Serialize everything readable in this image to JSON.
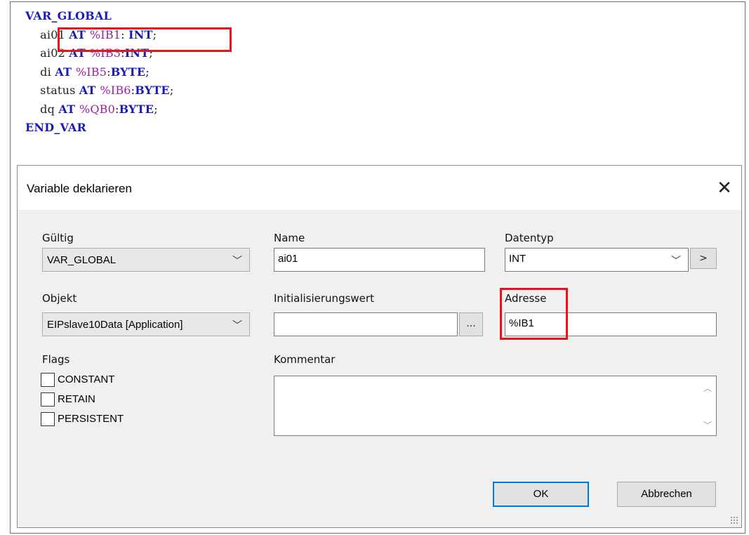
{
  "code": {
    "lines": [
      {
        "indent": "",
        "parts": [
          {
            "t": "VAR_GLOBAL",
            "c": "kw"
          }
        ]
      },
      {
        "indent": "    ",
        "parts": [
          {
            "t": "ai01 ",
            "c": "ident"
          },
          {
            "t": "AT ",
            "c": "kw"
          },
          {
            "t": "%IB1",
            "c": "addr"
          },
          {
            "t": ": ",
            "c": "ident"
          },
          {
            "t": "INT",
            "c": "kw"
          },
          {
            "t": ";",
            "c": "ident"
          }
        ]
      },
      {
        "indent": "    ",
        "parts": [
          {
            "t": "ai02 ",
            "c": "ident"
          },
          {
            "t": "AT ",
            "c": "kw"
          },
          {
            "t": "%IB3",
            "c": "addr"
          },
          {
            "t": ":",
            "c": "ident"
          },
          {
            "t": "INT",
            "c": "kw"
          },
          {
            "t": ";",
            "c": "ident"
          }
        ]
      },
      {
        "indent": "    ",
        "parts": [
          {
            "t": "di ",
            "c": "ident"
          },
          {
            "t": "AT ",
            "c": "kw"
          },
          {
            "t": "%IB5",
            "c": "addr"
          },
          {
            "t": ":",
            "c": "ident"
          },
          {
            "t": "BYTE",
            "c": "kw"
          },
          {
            "t": ";",
            "c": "ident"
          }
        ]
      },
      {
        "indent": "    ",
        "parts": [
          {
            "t": "status ",
            "c": "ident"
          },
          {
            "t": "AT ",
            "c": "kw"
          },
          {
            "t": "%IB6",
            "c": "addr"
          },
          {
            "t": ":",
            "c": "ident"
          },
          {
            "t": "BYTE",
            "c": "kw"
          },
          {
            "t": ";",
            "c": "ident"
          }
        ]
      },
      {
        "indent": "    ",
        "parts": [
          {
            "t": "dq ",
            "c": "ident"
          },
          {
            "t": "AT ",
            "c": "kw"
          },
          {
            "t": "%QB0",
            "c": "addr"
          },
          {
            "t": ":",
            "c": "ident"
          },
          {
            "t": "BYTE",
            "c": "kw"
          },
          {
            "t": ";",
            "c": "ident"
          }
        ]
      },
      {
        "indent": "",
        "parts": [
          {
            "t": "END_VAR",
            "c": "kw"
          }
        ]
      }
    ]
  },
  "dialog": {
    "title": "Variable deklarieren",
    "close_icon": "close-icon",
    "gueltig": {
      "label": "Gültig",
      "value": "VAR_GLOBAL"
    },
    "name": {
      "label": "Name",
      "value": "ai01"
    },
    "datentyp": {
      "label": "Datentyp",
      "value": "INT",
      "button": ">"
    },
    "objekt": {
      "label": "Objekt",
      "value": "EIPslave10Data [Application]"
    },
    "init": {
      "label": "Initialisierungswert",
      "value": "",
      "button": "..."
    },
    "adresse": {
      "label": "Adresse",
      "value": "%IB1"
    },
    "flags": {
      "label": "Flags",
      "items": [
        {
          "label": "CONSTANT",
          "checked": false
        },
        {
          "label": "RETAIN",
          "checked": false
        },
        {
          "label": "PERSISTENT",
          "checked": false
        }
      ]
    },
    "kommentar": {
      "label": "Kommentar",
      "value": ""
    },
    "ok_label": "OK",
    "cancel_label": "Abbrechen"
  },
  "colors": {
    "keyword": "#1b1bb8",
    "address": "#9a1fa0",
    "highlight": "#e5141b",
    "primary_border": "#0078d7"
  }
}
